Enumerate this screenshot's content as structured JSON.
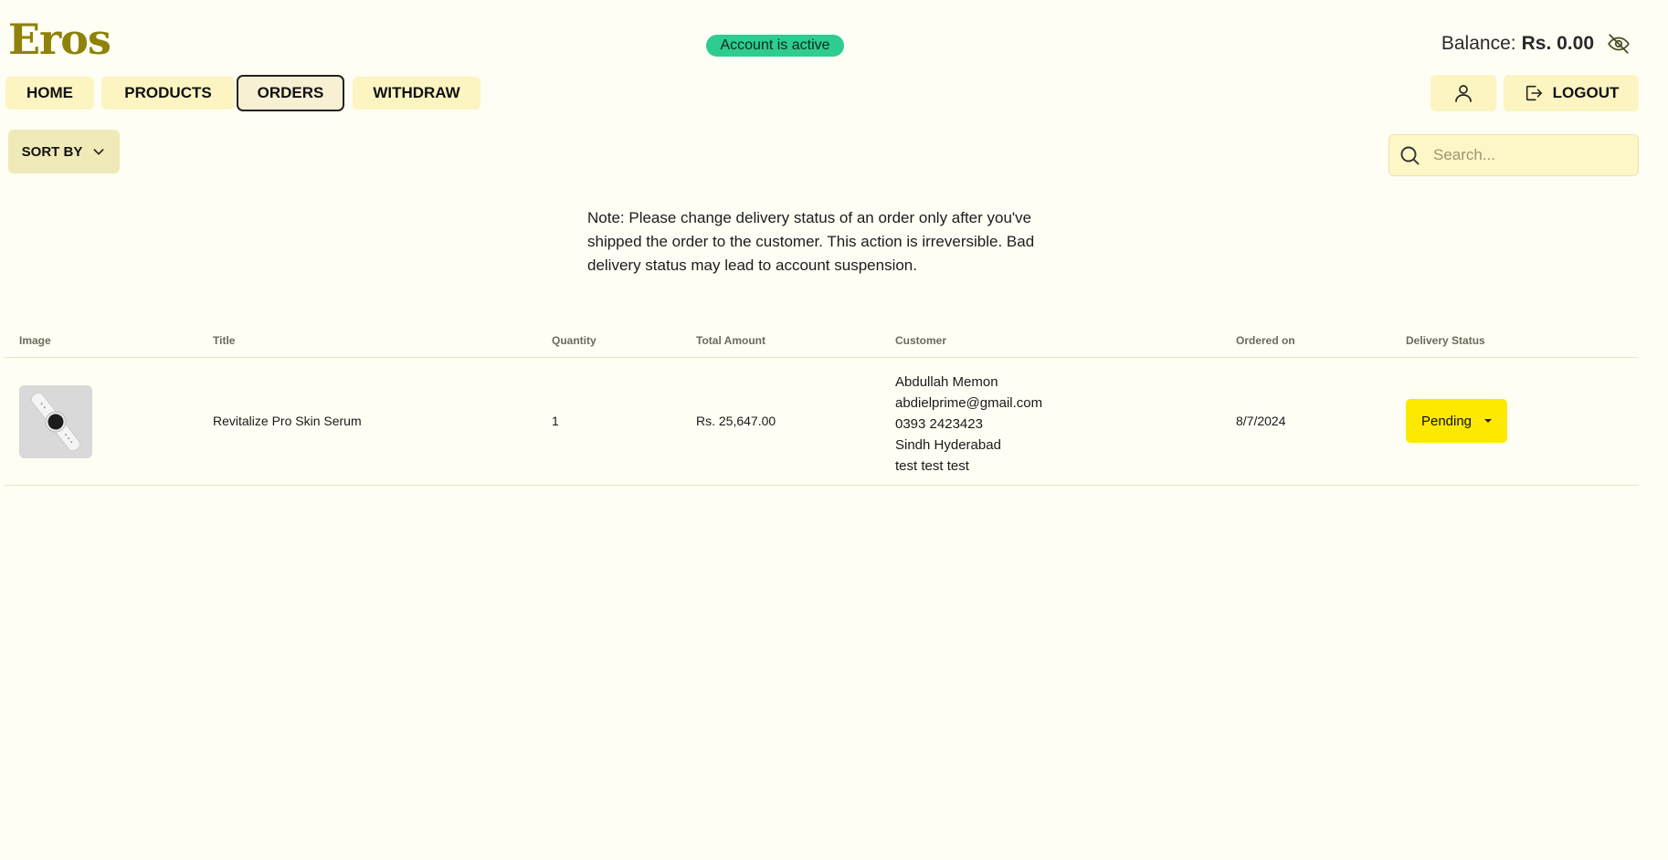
{
  "brand": {
    "logo": "Eros"
  },
  "account": {
    "status": "Account is active"
  },
  "balance": {
    "label": "Balance:",
    "amount": "Rs. 0.00"
  },
  "nav": {
    "items": [
      {
        "label": "HOME",
        "active": false
      },
      {
        "label": "PRODUCTS",
        "active": false
      },
      {
        "label": "ORDERS",
        "active": true
      },
      {
        "label": "WITHDRAW",
        "active": false
      }
    ],
    "logout_label": "LOGOUT"
  },
  "toolbar": {
    "sort_label": "SORT BY",
    "search_placeholder": "Search..."
  },
  "note": "Note: Please change delivery status of an order only after you've shipped the order to the customer. This action is irreversible. Bad delivery status may lead to account suspension.",
  "table": {
    "headers": [
      "Image",
      "Title",
      "Quantity",
      "Total Amount",
      "Customer",
      "Ordered on",
      "Delivery Status"
    ],
    "rows": [
      {
        "title": "Revitalize Pro Skin Serum",
        "quantity": "1",
        "total": "Rs. 25,647.00",
        "customer": {
          "name": "Abdullah Memon",
          "email": "abdielprime@gmail.com",
          "phone": "0393 2423423",
          "location": "Sindh Hyderabad",
          "address": "test test test"
        },
        "ordered_on": "8/7/2024",
        "status": "Pending"
      }
    ]
  },
  "colors": {
    "background": "#fefef4",
    "brand": "#8e8209",
    "nav_button": "#fcf5c2",
    "status_active": "#2ecc8f",
    "status_pending": "#fde900"
  }
}
